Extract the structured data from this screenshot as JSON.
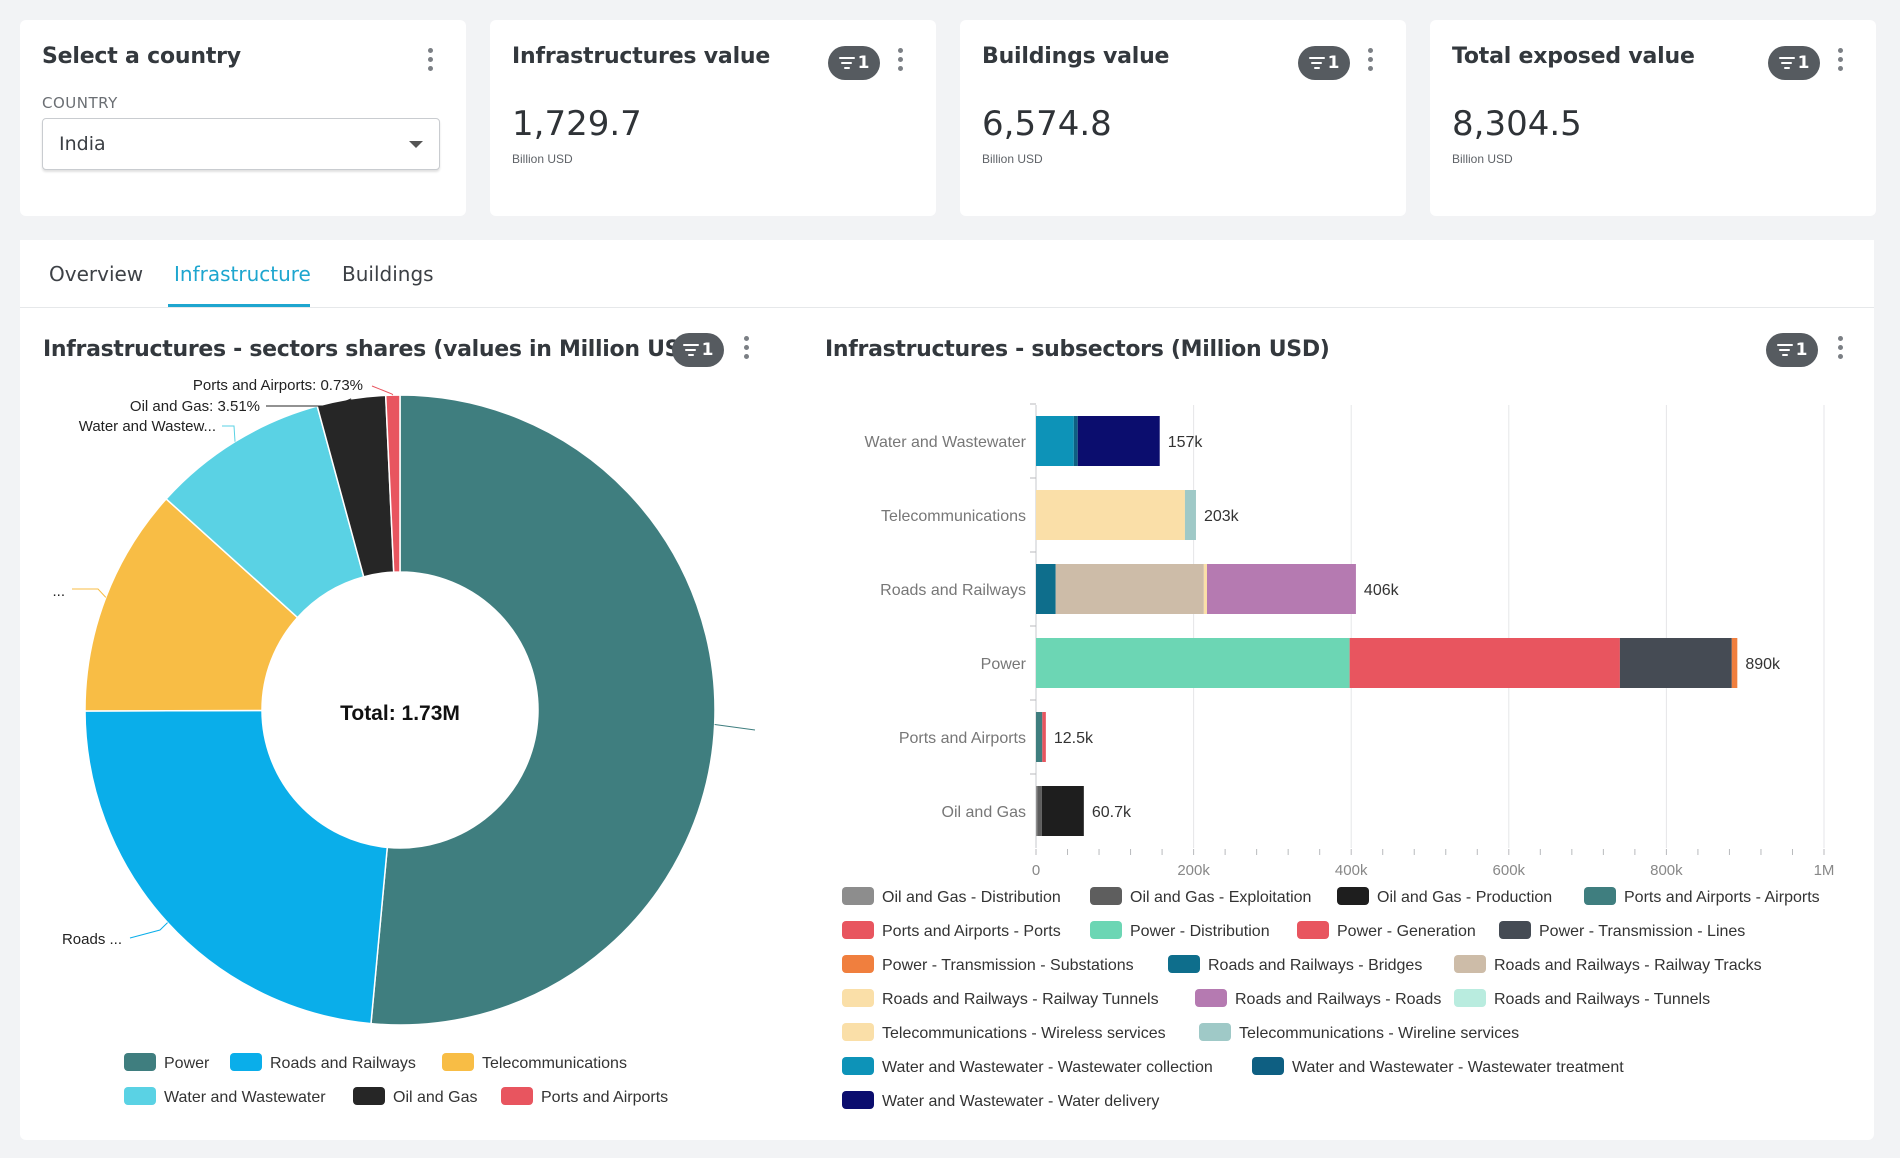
{
  "country_card": {
    "title": "Select a country",
    "label": "COUNTRY",
    "selected": "India"
  },
  "kpis": [
    {
      "title": "Infrastructures value",
      "value": "1,729.7",
      "unit": "Billion USD",
      "filter_count": "1"
    },
    {
      "title": "Buildings value",
      "value": "6,574.8",
      "unit": "Billion USD",
      "filter_count": "1"
    },
    {
      "title": "Total exposed value",
      "value": "8,304.5",
      "unit": "Billion USD",
      "filter_count": "1"
    }
  ],
  "tabs": [
    {
      "label": "Overview",
      "active": false
    },
    {
      "label": "Infrastructure",
      "active": true
    },
    {
      "label": "Buildings",
      "active": false
    }
  ],
  "donut_panel": {
    "title": "Infrastructures - sectors shares (values in Million USD)",
    "filter_count": "1",
    "center_label": "Total: 1.73M",
    "slice_labels": {
      "ports": "Ports and Airports: 0.73%",
      "oil": "Oil and Gas: 3.51%",
      "water": "Water and Wastew...",
      "telecom": "...",
      "roads": "Roads ..."
    }
  },
  "bar_panel": {
    "title": "Infrastructures - subsectors (Million USD)",
    "filter_count": "1"
  },
  "chart_data": [
    {
      "type": "pie",
      "center_label": "Total: 1.73M",
      "slices": [
        {
          "name": "Power",
          "value": 890,
          "color": "#3f7e7f"
        },
        {
          "name": "Roads and Railways",
          "value": 406,
          "color": "#0aaeea"
        },
        {
          "name": "Telecommunications",
          "value": 203,
          "color": "#f8bd45"
        },
        {
          "name": "Water and Wastewater",
          "value": 157,
          "color": "#5ad2e4"
        },
        {
          "name": "Oil and Gas",
          "value": 60.7,
          "color": "#262626"
        },
        {
          "name": "Ports and Airports",
          "value": 12.5,
          "color": "#e8555f"
        }
      ],
      "legend": [
        "Power",
        "Roads and Railways",
        "Telecommunications",
        "Water and Wastewater",
        "Oil and Gas",
        "Ports and Airports"
      ],
      "legend_position": "bottom"
    },
    {
      "type": "bar",
      "orientation": "horizontal",
      "stacked": true,
      "categories": [
        "Water and Wastewater",
        "Telecommunications",
        "Roads and Railways",
        "Power",
        "Ports and Airports",
        "Oil and Gas"
      ],
      "totals_labels": [
        "157k",
        "203k",
        "406k",
        "890k",
        "12.5k",
        "60.7k"
      ],
      "xlim": [
        0,
        1000000
      ],
      "xticks": [
        "0",
        "200k",
        "400k",
        "600k",
        "800k",
        "1M"
      ],
      "grid": true,
      "legend_position": "bottom",
      "series": [
        {
          "name": "Oil and Gas - Distribution",
          "color": "#8d8d8d",
          "values": [
            0,
            0,
            0,
            0,
            0,
            1500
          ]
        },
        {
          "name": "Oil and Gas - Exploitation",
          "color": "#5e5e5e",
          "values": [
            0,
            0,
            0,
            0,
            0,
            6000
          ]
        },
        {
          "name": "Oil and Gas - Production",
          "color": "#1e1e1e",
          "values": [
            0,
            0,
            0,
            0,
            0,
            53200
          ]
        },
        {
          "name": "Ports and Airports - Airports",
          "color": "#3f7e7f",
          "values": [
            0,
            0,
            0,
            0,
            8000,
            0
          ]
        },
        {
          "name": "Ports and Airports - Ports",
          "color": "#e8555f",
          "values": [
            0,
            0,
            0,
            0,
            4500,
            0
          ]
        },
        {
          "name": "Power - Distribution",
          "color": "#6cd6b4",
          "values": [
            0,
            0,
            0,
            398000,
            0,
            0
          ]
        },
        {
          "name": "Power - Generation",
          "color": "#e8555f",
          "values": [
            0,
            0,
            0,
            343000,
            0,
            0
          ]
        },
        {
          "name": "Power - Transmission - Lines",
          "color": "#454b54",
          "values": [
            0,
            0,
            0,
            142000,
            0,
            0
          ]
        },
        {
          "name": "Power - Transmission - Substations",
          "color": "#f07f3e",
          "values": [
            0,
            0,
            0,
            7000,
            0,
            0
          ]
        },
        {
          "name": "Roads and Railways - Bridges",
          "color": "#0e6e8c",
          "values": [
            0,
            0,
            25000,
            0,
            0,
            0
          ]
        },
        {
          "name": "Roads and Railways - Railway Tracks",
          "color": "#cdbca8",
          "values": [
            0,
            0,
            188000,
            0,
            0,
            0
          ]
        },
        {
          "name": "Roads and Railways - Railway Tunnels",
          "color": "#fadfa8",
          "values": [
            0,
            0,
            4000,
            0,
            0,
            0
          ]
        },
        {
          "name": "Roads and Railways - Roads",
          "color": "#b57ab1",
          "values": [
            0,
            0,
            189000,
            0,
            0,
            0
          ]
        },
        {
          "name": "Roads and Railways - Tunnels",
          "color": "#b9ecdf",
          "values": [
            0,
            0,
            0,
            0,
            0,
            0
          ]
        },
        {
          "name": "Telecommunications - Wireless services",
          "color": "#fadfa8",
          "values": [
            0,
            189000,
            0,
            0,
            0,
            0
          ]
        },
        {
          "name": "Telecommunications - Wireline services",
          "color": "#9fc9c7",
          "values": [
            0,
            14000,
            0,
            0,
            0,
            0
          ]
        },
        {
          "name": "Water and Wastewater - Wastewater collection",
          "color": "#0d93b8",
          "values": [
            48000,
            0,
            0,
            0,
            0,
            0
          ]
        },
        {
          "name": "Water and Wastewater - Wastewater treatment",
          "color": "#0e5f82",
          "values": [
            5000,
            0,
            0,
            0,
            0,
            0
          ]
        },
        {
          "name": "Water and Wastewater - Water delivery",
          "color": "#0b0d6e",
          "values": [
            104000,
            0,
            0,
            0,
            0,
            0
          ]
        }
      ]
    }
  ]
}
